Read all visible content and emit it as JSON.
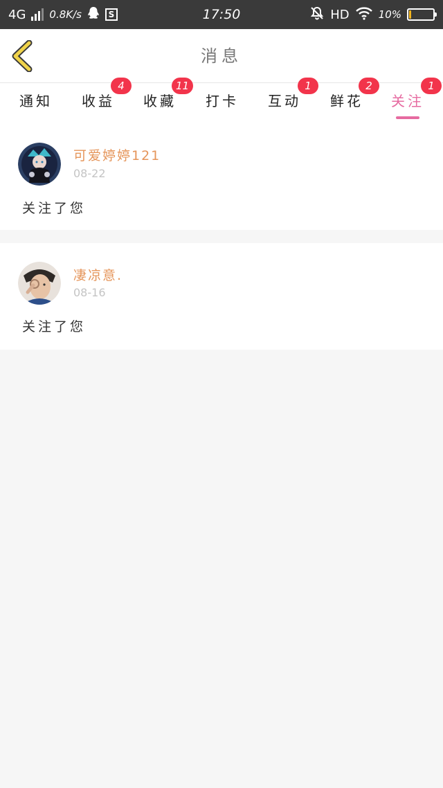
{
  "status_bar": {
    "network": "4G",
    "speed": "0.8K/s",
    "time": "17:50",
    "hd": "HD",
    "battery_percent": "10%",
    "battery_level": 0.1,
    "icons": [
      "signal-icon",
      "qq-icon",
      "s-box-icon",
      "mute-bell-icon",
      "wifi-icon",
      "battery-icon"
    ]
  },
  "header": {
    "title": "消息",
    "back_icon": "chevron-left-icon"
  },
  "tabs": [
    {
      "label": "通知",
      "badge": ""
    },
    {
      "label": "收益",
      "badge": "4"
    },
    {
      "label": "收藏",
      "badge": "11"
    },
    {
      "label": "打卡",
      "badge": ""
    },
    {
      "label": "互动",
      "badge": "1"
    },
    {
      "label": "鲜花",
      "badge": "2"
    },
    {
      "label": "关注",
      "badge": "1"
    }
  ],
  "active_tab": "关注",
  "colors": {
    "accent": "#e66aa0",
    "badge": "#f2344b",
    "username": "#e5955a",
    "back_icon": "#f0d34a"
  },
  "messages": [
    {
      "username": "可爱婷婷121",
      "date": "08-22",
      "text": "关注了您"
    },
    {
      "username": "凄凉意.",
      "date": "08-16",
      "text": "关注了您"
    }
  ]
}
